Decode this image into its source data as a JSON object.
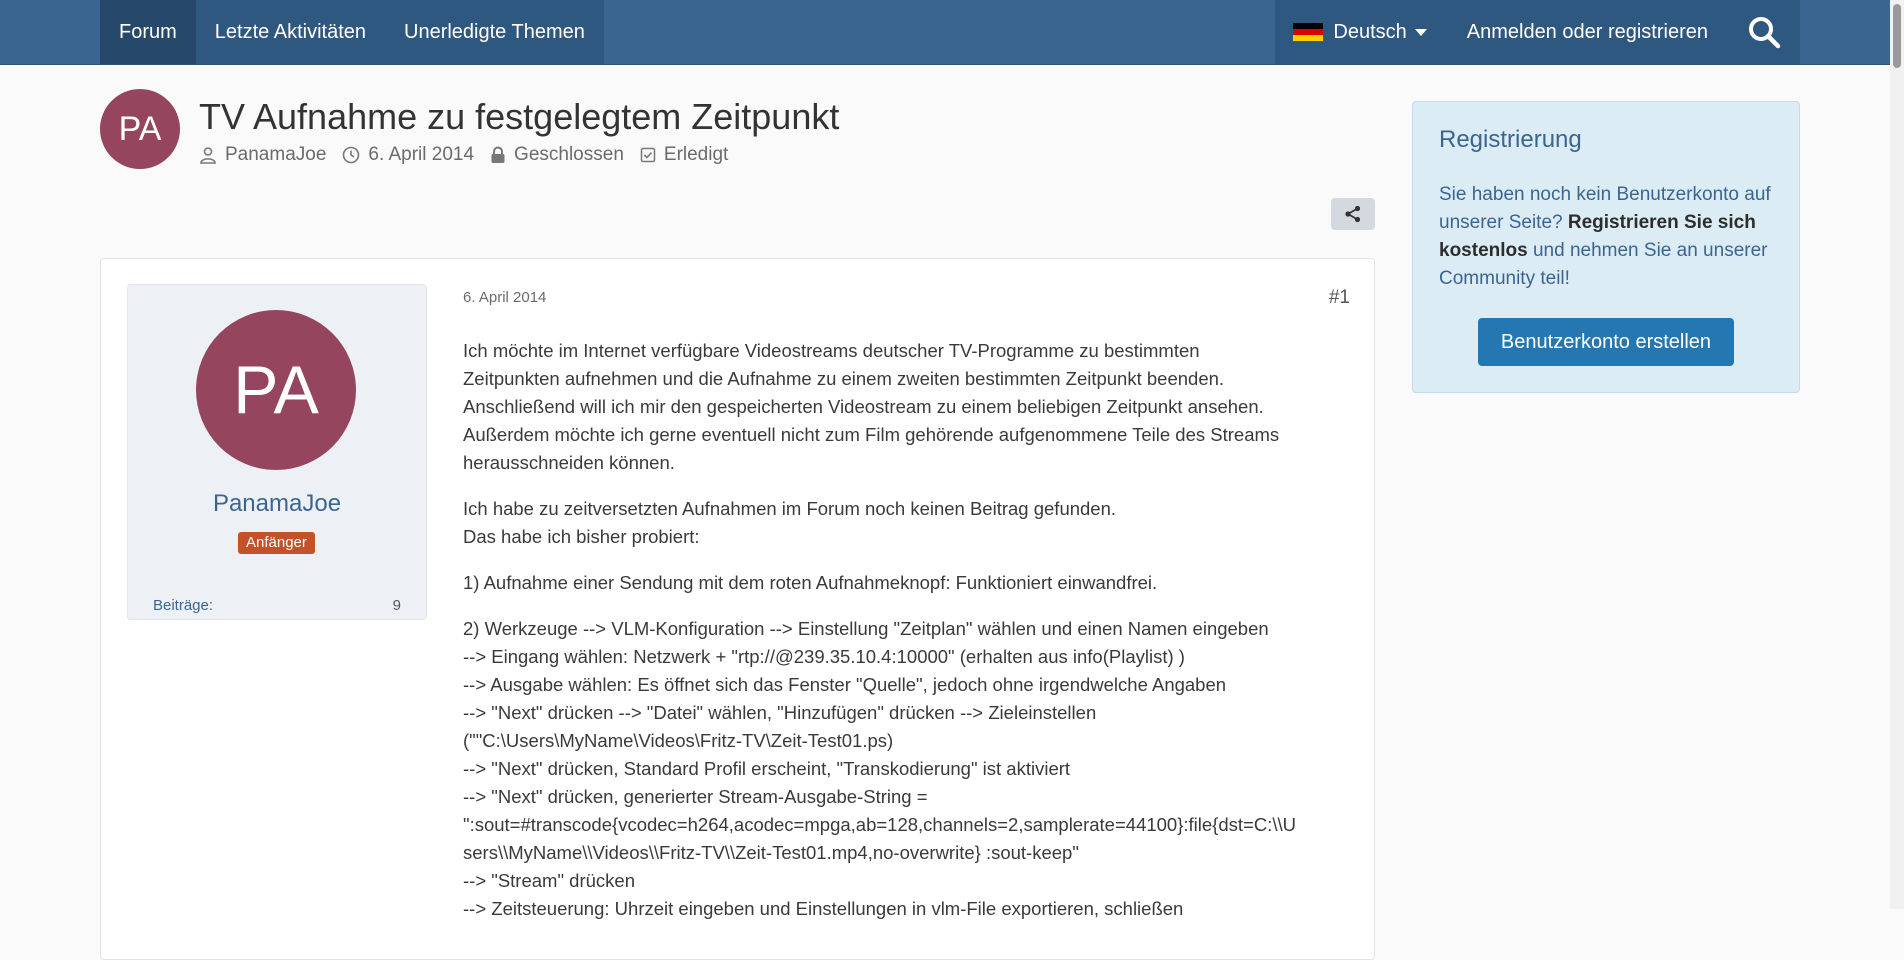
{
  "nav": {
    "items": [
      {
        "label": "Forum"
      },
      {
        "label": "Letzte Aktivitäten"
      },
      {
        "label": "Unerledigte Themen"
      }
    ],
    "language": "Deutsch",
    "login": "Anmelden oder registrieren"
  },
  "thread": {
    "avatar_initials": "PA",
    "title": "TV Aufnahme zu festgelegtem Zeitpunkt",
    "author": "PanamaJoe",
    "date": "6. April 2014",
    "status_closed": "Geschlossen",
    "status_done": "Erledigt"
  },
  "post": {
    "user": {
      "initials": "PA",
      "name": "PanamaJoe",
      "rank": "Anfänger",
      "stat_label": "Beiträge:",
      "stat_value": "9"
    },
    "date": "6. April 2014",
    "number": "#1",
    "paragraphs": [
      [
        "Ich möchte im Internet verfügbare Videostreams deutscher TV-Programme zu bestimmten",
        "Zeitpunkten aufnehmen und die Aufnahme zu einem zweiten bestimmten Zeitpunkt beenden.",
        "Anschließend will ich mir den gespeicherten Videostream zu einem beliebigen Zeitpunkt ansehen.",
        "Außerdem möchte ich gerne eventuell nicht zum Film gehörende aufgenommene Teile des Streams",
        "herausschneiden können."
      ],
      [
        "Ich habe zu zeitversetzten Aufnahmen im Forum noch keinen Beitrag gefunden.",
        "Das habe ich bisher probiert:"
      ],
      [
        "1) Aufnahme einer Sendung mit dem roten Aufnahmeknopf: Funktioniert einwandfrei."
      ],
      [
        "2) Werkzeuge --> VLM-Konfiguration --> Einstellung \"Zeitplan\" wählen und einen Namen eingeben",
        "--> Eingang wählen: Netzwerk + \"rtp://@239.35.10.4:10000\" (erhalten aus info(Playlist) )",
        "--> Ausgabe wählen: Es öffnet sich das Fenster \"Quelle\", jedoch ohne irgendwelche Angaben",
        "--> \"Next\" drücken --> \"Datei\" wählen, \"Hinzufügen\" drücken --> Zieleinstellen",
        "(\"\"C:\\Users\\MyName\\Videos\\Fritz-TV\\Zeit-Test01.ps)",
        "--> \"Next\" drücken, Standard Profil erscheint, \"Transkodierung\" ist aktiviert",
        "--> \"Next\" drücken, generierter Stream-Ausgabe-String =",
        "\":sout=#transcode{vcodec=h264,acodec=mpga,ab=128,channels=2,samplerate=44100}:file{dst=C:\\\\U",
        "sers\\\\MyName\\\\Videos\\\\Fritz-TV\\\\Zeit-Test01.mp4,no-overwrite} :sout-keep\"",
        "--> \"Stream\" drücken",
        "--> Zeitsteuerung: Uhrzeit eingeben und Einstellungen in  vlm-File exportieren, schließen"
      ]
    ]
  },
  "sidebar": {
    "title": "Registrierung",
    "text_1": "Sie haben noch kein Benutzerkonto auf unserer Seite?",
    "text_bold": "Registrieren Sie sich kostenlos",
    "text_2": "und nehmen Sie an unserer Community teil!",
    "button": "Benutzerkonto erstellen"
  },
  "colors": {
    "nav_bg": "#3a6591",
    "avatar": "#95455e",
    "rank_badge": "#c3522a",
    "primary_button": "#2577b1",
    "sidebar_bg": "#dcecf5"
  }
}
